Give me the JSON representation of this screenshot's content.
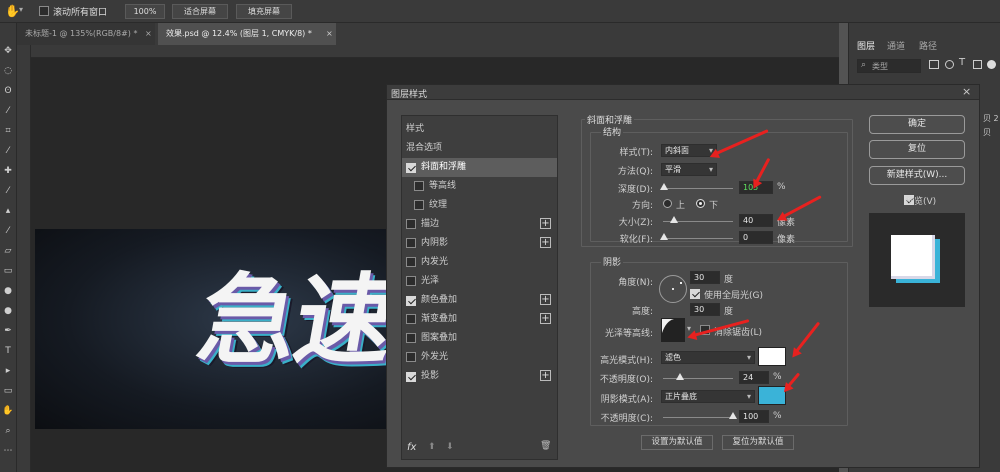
{
  "options_bar": {
    "scroll_all_label": "滚动所有窗口",
    "zoom_value": "100%",
    "fit_screen_label": "适合屏幕",
    "fill_screen_label": "填充屏幕"
  },
  "tabs": [
    {
      "label": "未标题-1 @ 135%(RGB/8#) *",
      "close": "×"
    },
    {
      "label": "效果.psd @ 12.4% (图层 1, CMYK/8) *",
      "close": "×"
    }
  ],
  "canvas": {
    "text": "急速"
  },
  "right_panel": {
    "tabs": [
      "图层",
      "通道",
      "路径"
    ],
    "filter_label": "类型",
    "layer_hint_1": "贝 2",
    "layer_hint_2": "贝"
  },
  "dialog": {
    "title": "图层样式",
    "close_icon": "×",
    "left_list": [
      {
        "label": "样式",
        "checkbox": false,
        "checked": false,
        "plus": false
      },
      {
        "label": "混合选项",
        "checkbox": false,
        "checked": false,
        "plus": false
      },
      {
        "label": "斜面和浮雕",
        "checkbox": true,
        "checked": true,
        "plus": false,
        "selected": true
      },
      {
        "label": "等高线",
        "checkbox": true,
        "checked": false,
        "plus": false,
        "sub": true
      },
      {
        "label": "纹理",
        "checkbox": true,
        "checked": false,
        "plus": false,
        "sub": true
      },
      {
        "label": "描边",
        "checkbox": true,
        "checked": false,
        "plus": true
      },
      {
        "label": "内阴影",
        "checkbox": true,
        "checked": false,
        "plus": true
      },
      {
        "label": "内发光",
        "checkbox": true,
        "checked": false,
        "plus": false
      },
      {
        "label": "光泽",
        "checkbox": true,
        "checked": false,
        "plus": false
      },
      {
        "label": "颜色叠加",
        "checkbox": true,
        "checked": true,
        "plus": true
      },
      {
        "label": "渐变叠加",
        "checkbox": true,
        "checked": false,
        "plus": true
      },
      {
        "label": "图案叠加",
        "checkbox": true,
        "checked": false,
        "plus": false
      },
      {
        "label": "外发光",
        "checkbox": true,
        "checked": false,
        "plus": false
      },
      {
        "label": "投影",
        "checkbox": true,
        "checked": true,
        "plus": true
      }
    ],
    "fx_label": "fx",
    "bevel": {
      "section_title": "斜面和浮雕",
      "structure_title": "结构",
      "style_label": "样式(T):",
      "style_value": "内斜面",
      "technique_label": "方法(Q):",
      "technique_value": "平滑",
      "depth_label": "深度(D):",
      "depth_value": "105",
      "depth_unit": "%",
      "depth_fraction": 0.105,
      "direction_label": "方向:",
      "direction_up": "上",
      "direction_down": "下",
      "direction_selected": "down",
      "size_label": "大小(Z):",
      "size_value": "40",
      "size_unit": "像素",
      "size_fraction": 0.16,
      "soften_label": "软化(F):",
      "soften_value": "0",
      "soften_unit": "像素",
      "soften_fraction": 0
    },
    "shading": {
      "section_title": "阴影",
      "angle_label": "角度(N):",
      "angle_value": "30",
      "angle_unit": "度",
      "global_light_label": "使用全局光(G)",
      "global_light_checked": true,
      "altitude_label": "高度:",
      "altitude_value": "30",
      "altitude_unit": "度",
      "gloss_label": "光泽等高线:",
      "anti_alias_label": "消除锯齿(L)",
      "anti_alias_checked": false,
      "highlight_mode_label": "高光模式(H):",
      "highlight_mode_value": "滤色",
      "highlight_color": "#ffffff",
      "highlight_opacity_label": "不透明度(O):",
      "highlight_opacity_value": "24",
      "highlight_opacity_unit": "%",
      "highlight_opacity_fraction": 0.24,
      "shadow_mode_label": "阴影模式(A):",
      "shadow_mode_value": "正片叠底",
      "shadow_color": "#3ab3d8",
      "shadow_opacity_label": "不透明度(C):",
      "shadow_opacity_value": "100",
      "shadow_opacity_unit": "%",
      "shadow_opacity_fraction": 1.0
    },
    "make_default_label": "设置为默认值",
    "reset_default_label": "复位为默认值",
    "ok_label": "确定",
    "reset_label": "复位",
    "new_style_label": "新建样式(W)...",
    "preview_label": "预览(V)",
    "preview_checked": true
  },
  "colors": {
    "arrow": "#e8211f",
    "accent_green": "#5ee05e"
  }
}
